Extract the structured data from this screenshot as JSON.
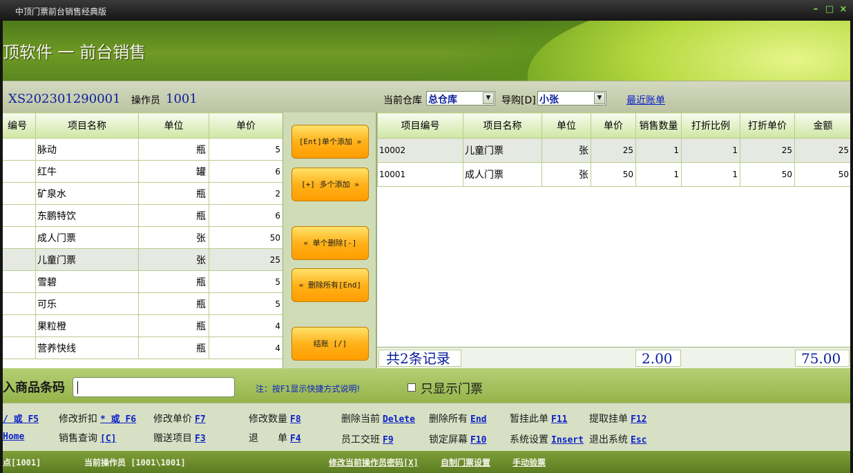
{
  "window": {
    "title": "中顶门票前台销售经典版",
    "controls": [
      "–",
      "□",
      "×"
    ]
  },
  "banner": {
    "title": "顶软件 一 前台销售"
  },
  "order": {
    "number": "XS202301290001",
    "operator_label": "操作员",
    "operator_value": "1001",
    "warehouse_label": "当前仓库",
    "warehouse_value": "总仓库",
    "guide_label": "导购[D]",
    "guide_value": "小张",
    "recent_link": "最近账单"
  },
  "product_table": {
    "columns": [
      "编号",
      "项目名称",
      "单位",
      "单价"
    ],
    "rows": [
      {
        "name": "脉动",
        "unit": "瓶",
        "price": "5"
      },
      {
        "name": "红牛",
        "unit": "罐",
        "price": "6"
      },
      {
        "name": "矿泉水",
        "unit": "瓶",
        "price": "2"
      },
      {
        "name": "东鹏特饮",
        "unit": "瓶",
        "price": "6"
      },
      {
        "name": "成人门票",
        "unit": "张",
        "price": "50"
      },
      {
        "name": "儿童门票",
        "unit": "张",
        "price": "25"
      },
      {
        "name": "雪碧",
        "unit": "瓶",
        "price": "5"
      },
      {
        "name": "可乐",
        "unit": "瓶",
        "price": "5"
      },
      {
        "name": "果粒橙",
        "unit": "瓶",
        "price": "4"
      },
      {
        "name": "营养快线",
        "unit": "瓶",
        "price": "4"
      }
    ]
  },
  "actions": {
    "add_single": "[Ent]单个添加 »",
    "add_multi": "[+] 多个添加 »",
    "del_single": "«  单个删除[-]",
    "del_all": "«  删除所有[End]",
    "checkout": "结账 [/]"
  },
  "sale_table": {
    "columns": [
      "项目编号",
      "项目名称",
      "单位",
      "单价",
      "销售数量",
      "打折比例",
      "打折单价",
      "金额"
    ],
    "rows": [
      {
        "code": "10002",
        "name": "儿童门票",
        "unit": "张",
        "price": "25",
        "qty": "1",
        "ratio": "1",
        "disc_price": "25",
        "amount": "25"
      },
      {
        "code": "10001",
        "name": "成人门票",
        "unit": "张",
        "price": "50",
        "qty": "1",
        "ratio": "1",
        "disc_price": "50",
        "amount": "50"
      }
    ],
    "summary": {
      "records": "共2条记录",
      "qty_total": "2.00",
      "amount_total": "75.00"
    }
  },
  "barcode": {
    "label": "入商品条码",
    "value": "",
    "note": "注：按F1显示快捷方式说明!",
    "only_ticket_label": "只显示门票"
  },
  "shortcuts": {
    "r1": [
      {
        "label": "",
        "key": "/ 或 F5"
      },
      {
        "label": "修改折扣",
        "key": "* 或 F6"
      },
      {
        "label": "修改单价",
        "key": "F7"
      },
      {
        "label": "修改数量",
        "key": "F8"
      },
      {
        "label": "删除当前",
        "key": "Delete"
      },
      {
        "label": "删除所有",
        "key": "End"
      },
      {
        "label": "暂挂此单",
        "key": "F11"
      },
      {
        "label": "提取挂单",
        "key": "F12"
      }
    ],
    "r2": [
      {
        "label": "",
        "key": "Home"
      },
      {
        "label": "销售查询",
        "key": "[C]"
      },
      {
        "label": "赠送项目",
        "key": "F3"
      },
      {
        "label": "退　　单",
        "key": "F4"
      },
      {
        "label": "员工交班",
        "key": "F9"
      },
      {
        "label": "锁定屏幕",
        "key": "F10"
      },
      {
        "label": "系统设置",
        "key": "Insert"
      },
      {
        "label": "退出系统",
        "key": "Esc"
      }
    ]
  },
  "status": {
    "point": "点[1001]",
    "current_operator": "当前操作员 [1001\\1001]",
    "change_pwd": "修改当前操作员密码[X]",
    "custom_ticket": "自制门票设置",
    "manual_check": "手动验票"
  },
  "colors": {
    "accent_blue": "#0a1f9e",
    "link_blue": "#0a1fc8",
    "button_orange": "#ffb21a"
  }
}
